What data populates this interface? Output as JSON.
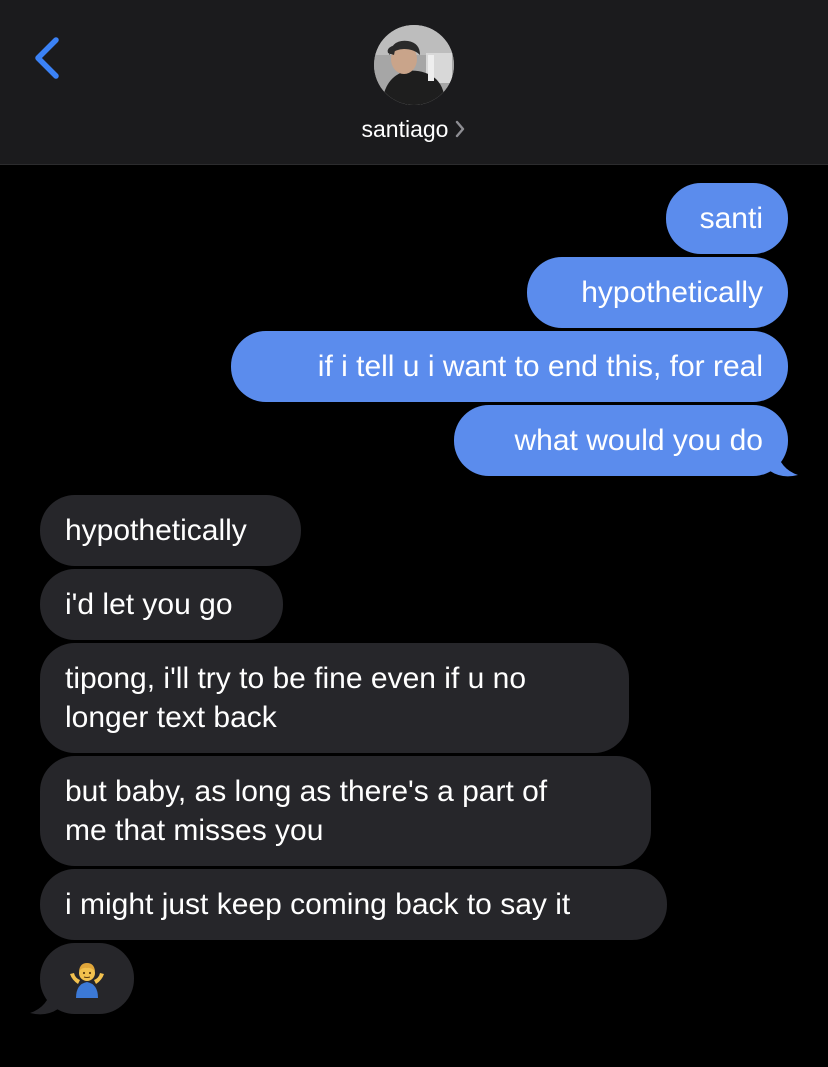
{
  "header": {
    "back_icon": "chevron-left-icon",
    "contact_name": "santiago",
    "contact_chevron_icon": "chevron-right-icon",
    "avatar_icon": "contact-photo"
  },
  "colors": {
    "header_bg": "#1b1b1d",
    "outgoing_bubble": "#5b8ced",
    "incoming_bubble": "#26262a",
    "accent": "#3b82f6"
  },
  "messages": {
    "outgoing": [
      {
        "text": "santi"
      },
      {
        "text": "hypothetically"
      },
      {
        "text": "if i tell u i want to end this, for real"
      },
      {
        "text": "what would you do"
      }
    ],
    "incoming": [
      {
        "text": "hypothetically"
      },
      {
        "text": "i'd let you go"
      },
      {
        "line1": "tipong, i'll try to be fine even if u no",
        "line2": "longer text back"
      },
      {
        "line1": "but baby, as long as there's a part of",
        "line2": "me that misses you"
      },
      {
        "text": "i might just keep coming back to say it"
      },
      {
        "emoji": "man-shrugging-emoji"
      }
    ]
  }
}
